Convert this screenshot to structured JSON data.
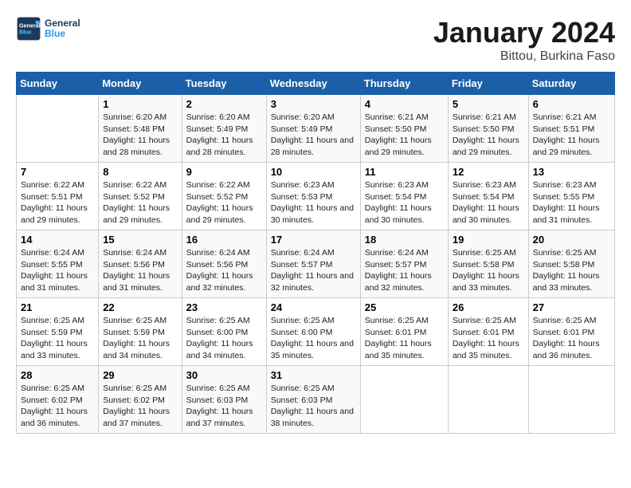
{
  "header": {
    "logo_line1": "General",
    "logo_line2": "Blue",
    "title": "January 2024",
    "subtitle": "Bittou, Burkina Faso"
  },
  "days_of_week": [
    "Sunday",
    "Monday",
    "Tuesday",
    "Wednesday",
    "Thursday",
    "Friday",
    "Saturday"
  ],
  "weeks": [
    [
      {
        "num": "",
        "sunrise": "",
        "sunset": "",
        "daylight": ""
      },
      {
        "num": "1",
        "sunrise": "6:20 AM",
        "sunset": "5:48 PM",
        "daylight": "11 hours and 28 minutes."
      },
      {
        "num": "2",
        "sunrise": "6:20 AM",
        "sunset": "5:49 PM",
        "daylight": "11 hours and 28 minutes."
      },
      {
        "num": "3",
        "sunrise": "6:20 AM",
        "sunset": "5:49 PM",
        "daylight": "11 hours and 28 minutes."
      },
      {
        "num": "4",
        "sunrise": "6:21 AM",
        "sunset": "5:50 PM",
        "daylight": "11 hours and 29 minutes."
      },
      {
        "num": "5",
        "sunrise": "6:21 AM",
        "sunset": "5:50 PM",
        "daylight": "11 hours and 29 minutes."
      },
      {
        "num": "6",
        "sunrise": "6:21 AM",
        "sunset": "5:51 PM",
        "daylight": "11 hours and 29 minutes."
      }
    ],
    [
      {
        "num": "7",
        "sunrise": "6:22 AM",
        "sunset": "5:51 PM",
        "daylight": "11 hours and 29 minutes."
      },
      {
        "num": "8",
        "sunrise": "6:22 AM",
        "sunset": "5:52 PM",
        "daylight": "11 hours and 29 minutes."
      },
      {
        "num": "9",
        "sunrise": "6:22 AM",
        "sunset": "5:52 PM",
        "daylight": "11 hours and 29 minutes."
      },
      {
        "num": "10",
        "sunrise": "6:23 AM",
        "sunset": "5:53 PM",
        "daylight": "11 hours and 30 minutes."
      },
      {
        "num": "11",
        "sunrise": "6:23 AM",
        "sunset": "5:54 PM",
        "daylight": "11 hours and 30 minutes."
      },
      {
        "num": "12",
        "sunrise": "6:23 AM",
        "sunset": "5:54 PM",
        "daylight": "11 hours and 30 minutes."
      },
      {
        "num": "13",
        "sunrise": "6:23 AM",
        "sunset": "5:55 PM",
        "daylight": "11 hours and 31 minutes."
      }
    ],
    [
      {
        "num": "14",
        "sunrise": "6:24 AM",
        "sunset": "5:55 PM",
        "daylight": "11 hours and 31 minutes."
      },
      {
        "num": "15",
        "sunrise": "6:24 AM",
        "sunset": "5:56 PM",
        "daylight": "11 hours and 31 minutes."
      },
      {
        "num": "16",
        "sunrise": "6:24 AM",
        "sunset": "5:56 PM",
        "daylight": "11 hours and 32 minutes."
      },
      {
        "num": "17",
        "sunrise": "6:24 AM",
        "sunset": "5:57 PM",
        "daylight": "11 hours and 32 minutes."
      },
      {
        "num": "18",
        "sunrise": "6:24 AM",
        "sunset": "5:57 PM",
        "daylight": "11 hours and 32 minutes."
      },
      {
        "num": "19",
        "sunrise": "6:25 AM",
        "sunset": "5:58 PM",
        "daylight": "11 hours and 33 minutes."
      },
      {
        "num": "20",
        "sunrise": "6:25 AM",
        "sunset": "5:58 PM",
        "daylight": "11 hours and 33 minutes."
      }
    ],
    [
      {
        "num": "21",
        "sunrise": "6:25 AM",
        "sunset": "5:59 PM",
        "daylight": "11 hours and 33 minutes."
      },
      {
        "num": "22",
        "sunrise": "6:25 AM",
        "sunset": "5:59 PM",
        "daylight": "11 hours and 34 minutes."
      },
      {
        "num": "23",
        "sunrise": "6:25 AM",
        "sunset": "6:00 PM",
        "daylight": "11 hours and 34 minutes."
      },
      {
        "num": "24",
        "sunrise": "6:25 AM",
        "sunset": "6:00 PM",
        "daylight": "11 hours and 35 minutes."
      },
      {
        "num": "25",
        "sunrise": "6:25 AM",
        "sunset": "6:01 PM",
        "daylight": "11 hours and 35 minutes."
      },
      {
        "num": "26",
        "sunrise": "6:25 AM",
        "sunset": "6:01 PM",
        "daylight": "11 hours and 35 minutes."
      },
      {
        "num": "27",
        "sunrise": "6:25 AM",
        "sunset": "6:01 PM",
        "daylight": "11 hours and 36 minutes."
      }
    ],
    [
      {
        "num": "28",
        "sunrise": "6:25 AM",
        "sunset": "6:02 PM",
        "daylight": "11 hours and 36 minutes."
      },
      {
        "num": "29",
        "sunrise": "6:25 AM",
        "sunset": "6:02 PM",
        "daylight": "11 hours and 37 minutes."
      },
      {
        "num": "30",
        "sunrise": "6:25 AM",
        "sunset": "6:03 PM",
        "daylight": "11 hours and 37 minutes."
      },
      {
        "num": "31",
        "sunrise": "6:25 AM",
        "sunset": "6:03 PM",
        "daylight": "11 hours and 38 minutes."
      },
      {
        "num": "",
        "sunrise": "",
        "sunset": "",
        "daylight": ""
      },
      {
        "num": "",
        "sunrise": "",
        "sunset": "",
        "daylight": ""
      },
      {
        "num": "",
        "sunrise": "",
        "sunset": "",
        "daylight": ""
      }
    ]
  ],
  "labels": {
    "sunrise_prefix": "Sunrise: ",
    "sunset_prefix": "Sunset: ",
    "daylight_prefix": "Daylight: "
  }
}
